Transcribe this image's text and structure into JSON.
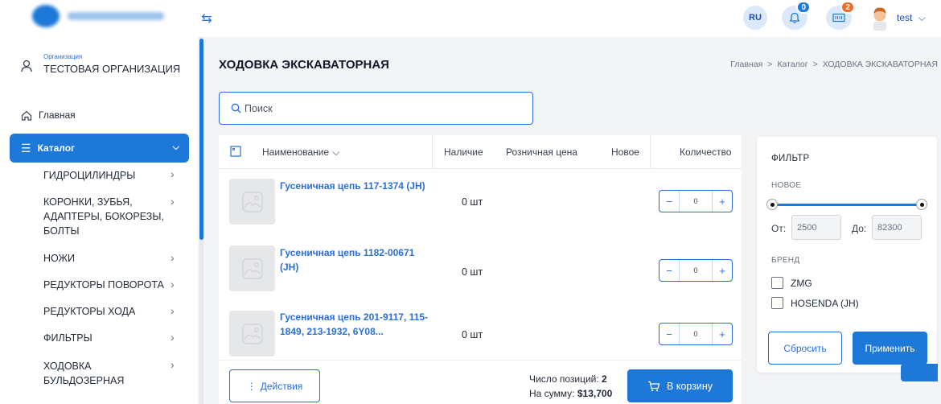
{
  "topbar": {
    "lang": "RU",
    "notifications_count": "0",
    "cart_count": "2",
    "username": "test",
    "icons": [
      "collapse-sidebar-icon",
      "bell-icon",
      "cart-icon",
      "avatar-icon",
      "chevron-down-icon"
    ]
  },
  "sidebar": {
    "org_label": "Организация",
    "org_name": "ТЕСТОВАЯ ОРГАНИЗАЦИЯ",
    "home_label": "Главная",
    "catalog_label": "Каталог",
    "items": [
      {
        "label": "ГИДРОЦИЛИНДРЫ"
      },
      {
        "label": "КОРОНКИ, ЗУБЬЯ, АДАПТЕРЫ, БОКОРЕЗЫ, БОЛТЫ"
      },
      {
        "label": "НОЖИ"
      },
      {
        "label": "РЕДУКТОРЫ ПОВОРОТА"
      },
      {
        "label": "РЕДУКТОРЫ ХОДА"
      },
      {
        "label": "ФИЛЬТРЫ"
      },
      {
        "label": "ХОДОВКА БУЛЬДОЗЕРНАЯ"
      }
    ]
  },
  "page": {
    "title": "ХОДОВКА ЭКСКАВАТОРНАЯ",
    "breadcrumb": [
      "Главная",
      "Каталог",
      "ХОДОВКА ЭКСКАВАТОРНАЯ"
    ],
    "breadcrumb_sep": ">",
    "search_placeholder": "Поиск"
  },
  "table": {
    "columns": {
      "name": "Наименование",
      "stock": "Наличие",
      "price": "Розничная цена",
      "new": "Новое",
      "qty": "Количество"
    },
    "rows": [
      {
        "name": "Гусеничная цепь 117-1374 (JH)",
        "stock": "0 шт",
        "qty": "0"
      },
      {
        "name": "Гусеничная цепь 1182-00671 (JH)",
        "stock": "0 шт",
        "qty": "0"
      },
      {
        "name": "Гусеничная цепь 201-9117, 115-1849, 213-1932, 6Y08...",
        "stock": "0 шт",
        "qty": "0"
      }
    ],
    "stepper_minus": "−",
    "stepper_plus": "+"
  },
  "footer": {
    "actions_label": "Действия",
    "actions_prefix": "⋮",
    "positions_label": "Число позиций:",
    "positions_value": "2",
    "sum_label": "На сумму:",
    "sum_value": "$13,700",
    "cart_label": "В корзину"
  },
  "filter": {
    "title": "ФИЛЬТР",
    "new_section": "НОВОЕ",
    "from_label": "От:",
    "from_value": "2500",
    "to_label": "До:",
    "to_value": "82300",
    "brand_section": "БРЕНД",
    "brands": [
      "ZMG",
      "HOSENDA (JH)"
    ],
    "reset_label": "Сбросить",
    "apply_label": "Применить"
  },
  "colors": {
    "accent": "#1e78d8",
    "badge_orange": "#f06a2a",
    "background": "#f3f4f6"
  }
}
